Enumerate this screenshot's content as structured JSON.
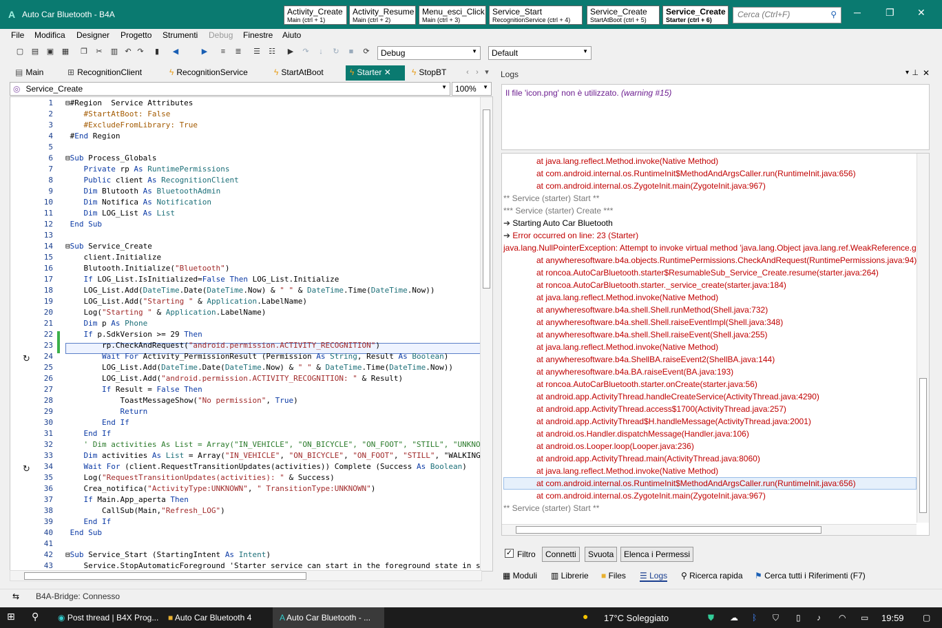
{
  "window": {
    "icon": "b4a-logo-icon",
    "title": "Auto Car Bluetooth - B4A",
    "minimize": "─",
    "maximize": "❐",
    "close": "✕"
  },
  "quick_tabs": [
    {
      "name": "Activity_Create",
      "hint": "Main (ctrl + 1)"
    },
    {
      "name": "Activity_Resume",
      "hint": "Main (ctrl + 2)"
    },
    {
      "name": "Menu_esci_Click",
      "hint": "Main (ctrl + 3)"
    },
    {
      "name": "Service_Start",
      "hint": "RecognitionService (ctrl + 4)"
    },
    {
      "name": "Service_Create",
      "hint": "StartAtBoot (ctrl + 5)"
    },
    {
      "name": "Service_Create",
      "hint": "Starter (ctrl + 6)"
    }
  ],
  "search": {
    "placeholder": "Cerca (Ctrl+F)"
  },
  "menu": [
    "File",
    "Modifica",
    "Designer",
    "Progetto",
    "Strumenti",
    "Debug",
    "Finestre",
    "Aiuto"
  ],
  "toolbar": {
    "config": "Debug",
    "build": "Default"
  },
  "file_tabs": [
    {
      "label": "Main",
      "icon": "designer-icon"
    },
    {
      "label": "RecognitionClient",
      "icon": "class-icon"
    },
    {
      "label": "RecognitionService",
      "icon": "service-icon"
    },
    {
      "label": "StartAtBoot",
      "icon": "service-icon"
    },
    {
      "label": "Starter",
      "icon": "service-icon",
      "active": true,
      "close": "✕"
    },
    {
      "label": "StopBT",
      "icon": "service-icon"
    }
  ],
  "sub_selector": "Service_Create",
  "zoom": "100%",
  "code_lines": [
    {
      "n": "1",
      "t": "⊟#Region  Service Attributes"
    },
    {
      "n": "2",
      "t": "    #StartAtBoot: False"
    },
    {
      "n": "3",
      "t": "    #ExcludeFromLibrary: True"
    },
    {
      "n": "4",
      "t": " #End Region"
    },
    {
      "n": "5",
      "t": ""
    },
    {
      "n": "6",
      "t": "⊟Sub Process_Globals"
    },
    {
      "n": "7",
      "t": "    Private rp As RuntimePermissions"
    },
    {
      "n": "8",
      "t": "    Public client As RecognitionClient"
    },
    {
      "n": "9",
      "t": "    Dim Blutooth As BluetoothAdmin"
    },
    {
      "n": "10",
      "t": "    Dim Notifica As Notification"
    },
    {
      "n": "11",
      "t": "    Dim LOG_List As List"
    },
    {
      "n": "12",
      "t": " End Sub"
    },
    {
      "n": "13",
      "t": ""
    },
    {
      "n": "14",
      "t": "⊟Sub Service_Create"
    },
    {
      "n": "15",
      "t": "    client.Initialize"
    },
    {
      "n": "16",
      "t": "    Blutooth.Initialize(\"Bluetooth\")"
    },
    {
      "n": "17",
      "t": "    If LOG_List.IsInitialized=False Then LOG_List.Initialize"
    },
    {
      "n": "18",
      "t": "    LOG_List.Add(DateTime.Date(DateTime.Now) & \" \" & DateTime.Time(DateTime.Now))"
    },
    {
      "n": "19",
      "t": "    LOG_List.Add(\"Starting \" & Application.LabelName)"
    },
    {
      "n": "20",
      "t": "    Log(\"Starting \" & Application.LabelName)"
    },
    {
      "n": "21",
      "t": "    Dim p As Phone"
    },
    {
      "n": "22",
      "t": "    If p.SdkVersion >= 29 Then"
    },
    {
      "n": "23",
      "t": "        rp.CheckAndRequest(\"android.permission.ACTIVITY_RECOGNITION\")"
    },
    {
      "n": "24",
      "t": "        Wait For Activity_PermissionResult (Permission As String, Result As Boolean)"
    },
    {
      "n": "25",
      "t": "        LOG_List.Add(DateTime.Date(DateTime.Now) & \" \" & DateTime.Time(DateTime.Now))"
    },
    {
      "n": "26",
      "t": "        LOG_List.Add(\"android.permission.ACTIVITY_RECOGNITION: \" & Result)"
    },
    {
      "n": "27",
      "t": "        If Result = False Then"
    },
    {
      "n": "28",
      "t": "            ToastMessageShow(\"No permission\", True)"
    },
    {
      "n": "29",
      "t": "            Return"
    },
    {
      "n": "30",
      "t": "        End If"
    },
    {
      "n": "31",
      "t": "    End If"
    },
    {
      "n": "32",
      "t": "    ' Dim activities As List = Array(\"IN_VEHICLE\", \"ON_BICYCLE\", \"ON_FOOT\", \"STILL\", \"UNKNOW"
    },
    {
      "n": "33",
      "t": "    Dim activities As List = Array(\"IN_VEHICLE\", \"ON_BICYCLE\", \"ON_FOOT\", \"STILL\", \"WALKING"
    },
    {
      "n": "34",
      "t": "    Wait For (client.RequestTransitionUpdates(activities)) Complete (Success As Boolean)"
    },
    {
      "n": "35",
      "t": "    Log(\"RequestTransitionUpdates(activities): \" & Success)"
    },
    {
      "n": "36",
      "t": "    Crea_notifica(\"ActivityType:UNKNOWN\", \" TransitionType:UNKNOWN\")"
    },
    {
      "n": "37",
      "t": "    If Main.App_aperta Then"
    },
    {
      "n": "38",
      "t": "        CallSub(Main,\"Refresh_LOG\")"
    },
    {
      "n": "39",
      "t": "    End If"
    },
    {
      "n": "40",
      "t": " End Sub"
    },
    {
      "n": "41",
      "t": ""
    },
    {
      "n": "42",
      "t": "⊟Sub Service_Start (StartingIntent As Intent)"
    },
    {
      "n": "43",
      "t": "    Service.StopAutomaticForeground 'Starter service can start in the foreground state in s"
    }
  ],
  "logs": {
    "title": "Logs",
    "warning": "Il file 'icon.png' non è utilizzato.",
    "warning_tag": "(warning #15)",
    "lines": [
      {
        "t": "at java.lang.reflect.Method.invoke(Native Method)",
        "k": "red",
        "i": true
      },
      {
        "t": "at com.android.internal.os.RuntimeInit$MethodAndArgsCaller.run(RuntimeInit.java:656)",
        "k": "red",
        "i": true
      },
      {
        "t": "at com.android.internal.os.ZygoteInit.main(ZygoteInit.java:967)",
        "k": "red",
        "i": true
      },
      {
        "t": "** Service (starter) Start **",
        "k": "gray",
        "i": false
      },
      {
        "t": "*** Service (starter) Create ***",
        "k": "gray",
        "i": false
      },
      {
        "t": "Starting Auto Car Bluetooth",
        "k": "blk",
        "i": false,
        "icon": "log-arrow-icon"
      },
      {
        "t": "Error occurred on line: 23 (Starter)",
        "k": "red",
        "i": false,
        "icon": "log-arrow-icon"
      },
      {
        "t": "java.lang.NullPointerException: Attempt to invoke virtual method 'java.lang.Object java.lang.ref.WeakReference.ge",
        "k": "red",
        "i": false,
        "flush": true
      },
      {
        "t": "at anywheresoftware.b4a.objects.RuntimePermissions.CheckAndRequest(RuntimePermissions.java:94)",
        "k": "red",
        "i": true
      },
      {
        "t": "at roncoa.AutoCarBluetooth.starter$ResumableSub_Service_Create.resume(starter.java:264)",
        "k": "red",
        "i": true
      },
      {
        "t": "at roncoa.AutoCarBluetooth.starter._service_create(starter.java:184)",
        "k": "red",
        "i": true
      },
      {
        "t": "at java.lang.reflect.Method.invoke(Native Method)",
        "k": "red",
        "i": true
      },
      {
        "t": "at anywheresoftware.b4a.shell.Shell.runMethod(Shell.java:732)",
        "k": "red",
        "i": true
      },
      {
        "t": "at anywheresoftware.b4a.shell.Shell.raiseEventImpl(Shell.java:348)",
        "k": "red",
        "i": true
      },
      {
        "t": "at anywheresoftware.b4a.shell.Shell.raiseEvent(Shell.java:255)",
        "k": "red",
        "i": true
      },
      {
        "t": "at java.lang.reflect.Method.invoke(Native Method)",
        "k": "red",
        "i": true
      },
      {
        "t": "at anywheresoftware.b4a.ShellBA.raiseEvent2(ShellBA.java:144)",
        "k": "red",
        "i": true
      },
      {
        "t": "at anywheresoftware.b4a.BA.raiseEvent(BA.java:193)",
        "k": "red",
        "i": true
      },
      {
        "t": "at roncoa.AutoCarBluetooth.starter.onCreate(starter.java:56)",
        "k": "red",
        "i": true
      },
      {
        "t": "at android.app.ActivityThread.handleCreateService(ActivityThread.java:4290)",
        "k": "red",
        "i": true
      },
      {
        "t": "at android.app.ActivityThread.access$1700(ActivityThread.java:257)",
        "k": "red",
        "i": true
      },
      {
        "t": "at android.app.ActivityThread$H.handleMessage(ActivityThread.java:2001)",
        "k": "red",
        "i": true
      },
      {
        "t": "at android.os.Handler.dispatchMessage(Handler.java:106)",
        "k": "red",
        "i": true
      },
      {
        "t": "at android.os.Looper.loop(Looper.java:236)",
        "k": "red",
        "i": true
      },
      {
        "t": "at android.app.ActivityThread.main(ActivityThread.java:8060)",
        "k": "red",
        "i": true
      },
      {
        "t": "at java.lang.reflect.Method.invoke(Native Method)",
        "k": "red",
        "i": true
      },
      {
        "t": "at com.android.internal.os.RuntimeInit$MethodAndArgsCaller.run(RuntimeInit.java:656)",
        "k": "red",
        "i": true
      },
      {
        "t": "at com.android.internal.os.ZygoteInit.main(ZygoteInit.java:967)",
        "k": "red",
        "i": true
      },
      {
        "t": "** Service (starter) Start **",
        "k": "gray",
        "i": false
      }
    ],
    "filter_label": "Filtro",
    "buttons": [
      "Connetti",
      "Svuota",
      "Elenca i Permessi"
    ]
  },
  "bottom_tabs": [
    "Moduli",
    "Librerie",
    "Files",
    "Logs",
    "Ricerca rapida",
    "Cerca tutti i Riferimenti (F7)"
  ],
  "status": "B4A-Bridge: Connesso",
  "taskbar": {
    "items": [
      "Post thread | B4X Prog...",
      "Auto Car Bluetooth 4",
      "Auto Car Bluetooth - ..."
    ],
    "weather": "17°C  Soleggiato",
    "time": "19:59"
  },
  "colors": {
    "accent": "#0a7a70",
    "error": "#c00000",
    "keyword": "#0b3aa5"
  }
}
